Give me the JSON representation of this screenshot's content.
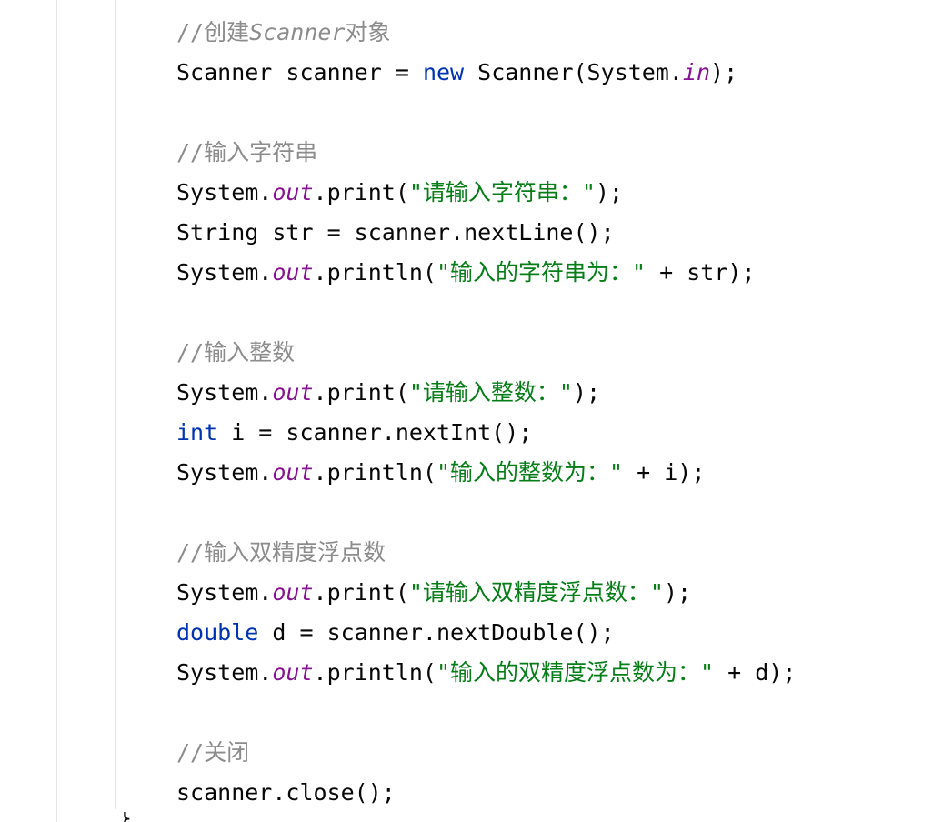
{
  "code_lines": [
    [
      {
        "t": "//创建",
        "c": "comment"
      },
      {
        "t": "Scanner",
        "c": "comment-em"
      },
      {
        "t": "对象",
        "c": "comment"
      }
    ],
    [
      {
        "t": "Scanner scanner = ",
        "c": "plain"
      },
      {
        "t": "new",
        "c": "keyword"
      },
      {
        "t": " Scanner(System.",
        "c": "plain"
      },
      {
        "t": "in",
        "c": "static"
      },
      {
        "t": ");",
        "c": "plain"
      }
    ],
    [],
    [
      {
        "t": "//输入字符串",
        "c": "comment"
      }
    ],
    [
      {
        "t": "System.",
        "c": "plain"
      },
      {
        "t": "out",
        "c": "static"
      },
      {
        "t": ".print(",
        "c": "plain"
      },
      {
        "t": "\"请输入字符串：\"",
        "c": "string"
      },
      {
        "t": ");",
        "c": "plain"
      }
    ],
    [
      {
        "t": "String str = scanner.nextLine();",
        "c": "plain"
      }
    ],
    [
      {
        "t": "System.",
        "c": "plain"
      },
      {
        "t": "out",
        "c": "static"
      },
      {
        "t": ".println(",
        "c": "plain"
      },
      {
        "t": "\"输入的字符串为：\"",
        "c": "string"
      },
      {
        "t": " + str);",
        "c": "plain"
      }
    ],
    [],
    [
      {
        "t": "//输入整数",
        "c": "comment"
      }
    ],
    [
      {
        "t": "System.",
        "c": "plain"
      },
      {
        "t": "out",
        "c": "static"
      },
      {
        "t": ".print(",
        "c": "plain"
      },
      {
        "t": "\"请输入整数：\"",
        "c": "string"
      },
      {
        "t": ");",
        "c": "plain"
      }
    ],
    [
      {
        "t": "int",
        "c": "keyword"
      },
      {
        "t": " i = scanner.nextInt();",
        "c": "plain"
      }
    ],
    [
      {
        "t": "System.",
        "c": "plain"
      },
      {
        "t": "out",
        "c": "static"
      },
      {
        "t": ".println(",
        "c": "plain"
      },
      {
        "t": "\"输入的整数为：\"",
        "c": "string"
      },
      {
        "t": " + i);",
        "c": "plain"
      }
    ],
    [],
    [
      {
        "t": "//输入双精度浮点数",
        "c": "comment"
      }
    ],
    [
      {
        "t": "System.",
        "c": "plain"
      },
      {
        "t": "out",
        "c": "static"
      },
      {
        "t": ".print(",
        "c": "plain"
      },
      {
        "t": "\"请输入双精度浮点数：\"",
        "c": "string"
      },
      {
        "t": ");",
        "c": "plain"
      }
    ],
    [
      {
        "t": "double",
        "c": "keyword"
      },
      {
        "t": " d = scanner.nextDouble();",
        "c": "plain"
      }
    ],
    [
      {
        "t": "System.",
        "c": "plain"
      },
      {
        "t": "out",
        "c": "static"
      },
      {
        "t": ".println(",
        "c": "plain"
      },
      {
        "t": "\"输入的双精度浮点数为：\"",
        "c": "string"
      },
      {
        "t": " + d);",
        "c": "plain"
      }
    ],
    [],
    [
      {
        "t": "//关闭",
        "c": "comment"
      }
    ],
    [
      {
        "t": "scanner.close();",
        "c": "plain"
      }
    ]
  ],
  "colors": {
    "comment": "#8c8c8c",
    "keyword": "#0033b3",
    "static_field": "#871094",
    "string": "#067d17",
    "plain": "#080808",
    "indent_guide": "#e4e4e4",
    "background": "#ffffff"
  },
  "closing_brace": "}"
}
